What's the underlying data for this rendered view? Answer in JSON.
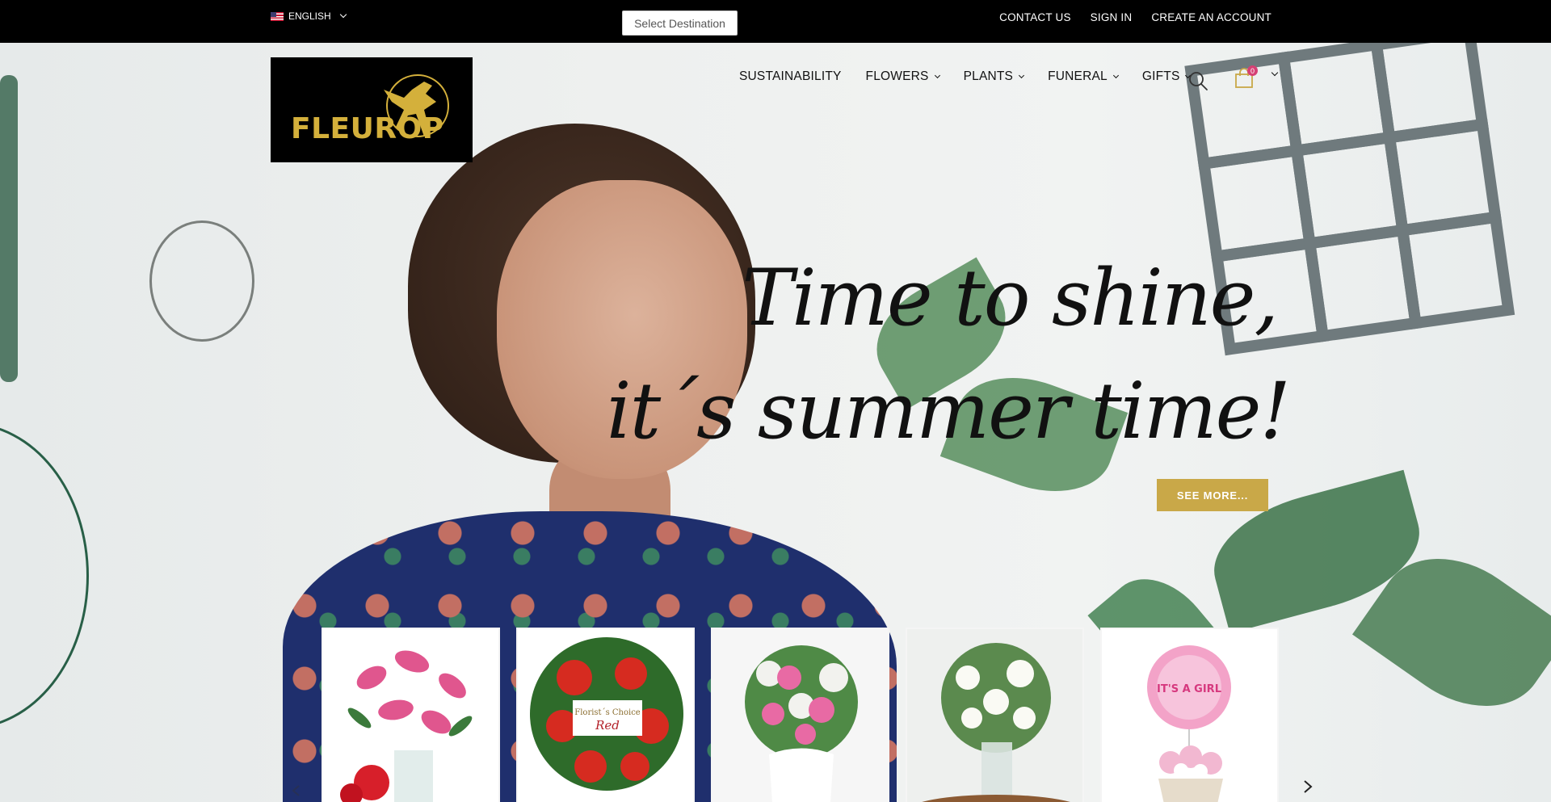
{
  "topbar": {
    "language": "ENGLISH",
    "destination_button": "Select Destination",
    "links": [
      "CONTACT US",
      "SIGN IN",
      "CREATE AN ACCOUNT"
    ]
  },
  "header": {
    "logo_text": "FLEUROP",
    "nav": [
      {
        "label": "SUSTAINABILITY",
        "has_dropdown": false
      },
      {
        "label": "FLOWERS",
        "has_dropdown": true
      },
      {
        "label": "PLANTS",
        "has_dropdown": true
      },
      {
        "label": "FUNERAL",
        "has_dropdown": true
      },
      {
        "label": "GIFTS",
        "has_dropdown": true
      }
    ],
    "cart_count": "0",
    "icons": [
      "search-icon",
      "shopping-bag-icon",
      "chevron-down-icon"
    ]
  },
  "hero": {
    "headline_line1": "Time to shine,",
    "headline_line2": "it´s summer time!",
    "cta": "SEE MORE..."
  },
  "products": [
    {
      "name": "pink-lilies-bouquet"
    },
    {
      "name": "florists-choice-red",
      "label_line1": "Florist´s Choice",
      "label_line2": "Red"
    },
    {
      "name": "pink-white-bouquet"
    },
    {
      "name": "white-lilies-bouquet"
    },
    {
      "name": "its-a-girl-balloon",
      "balloon_text": "IT'S A GIRL"
    }
  ],
  "colors": {
    "topbar_bg": "#000000",
    "accent_gold": "#c9a848",
    "cart_badge": "#d64074"
  }
}
